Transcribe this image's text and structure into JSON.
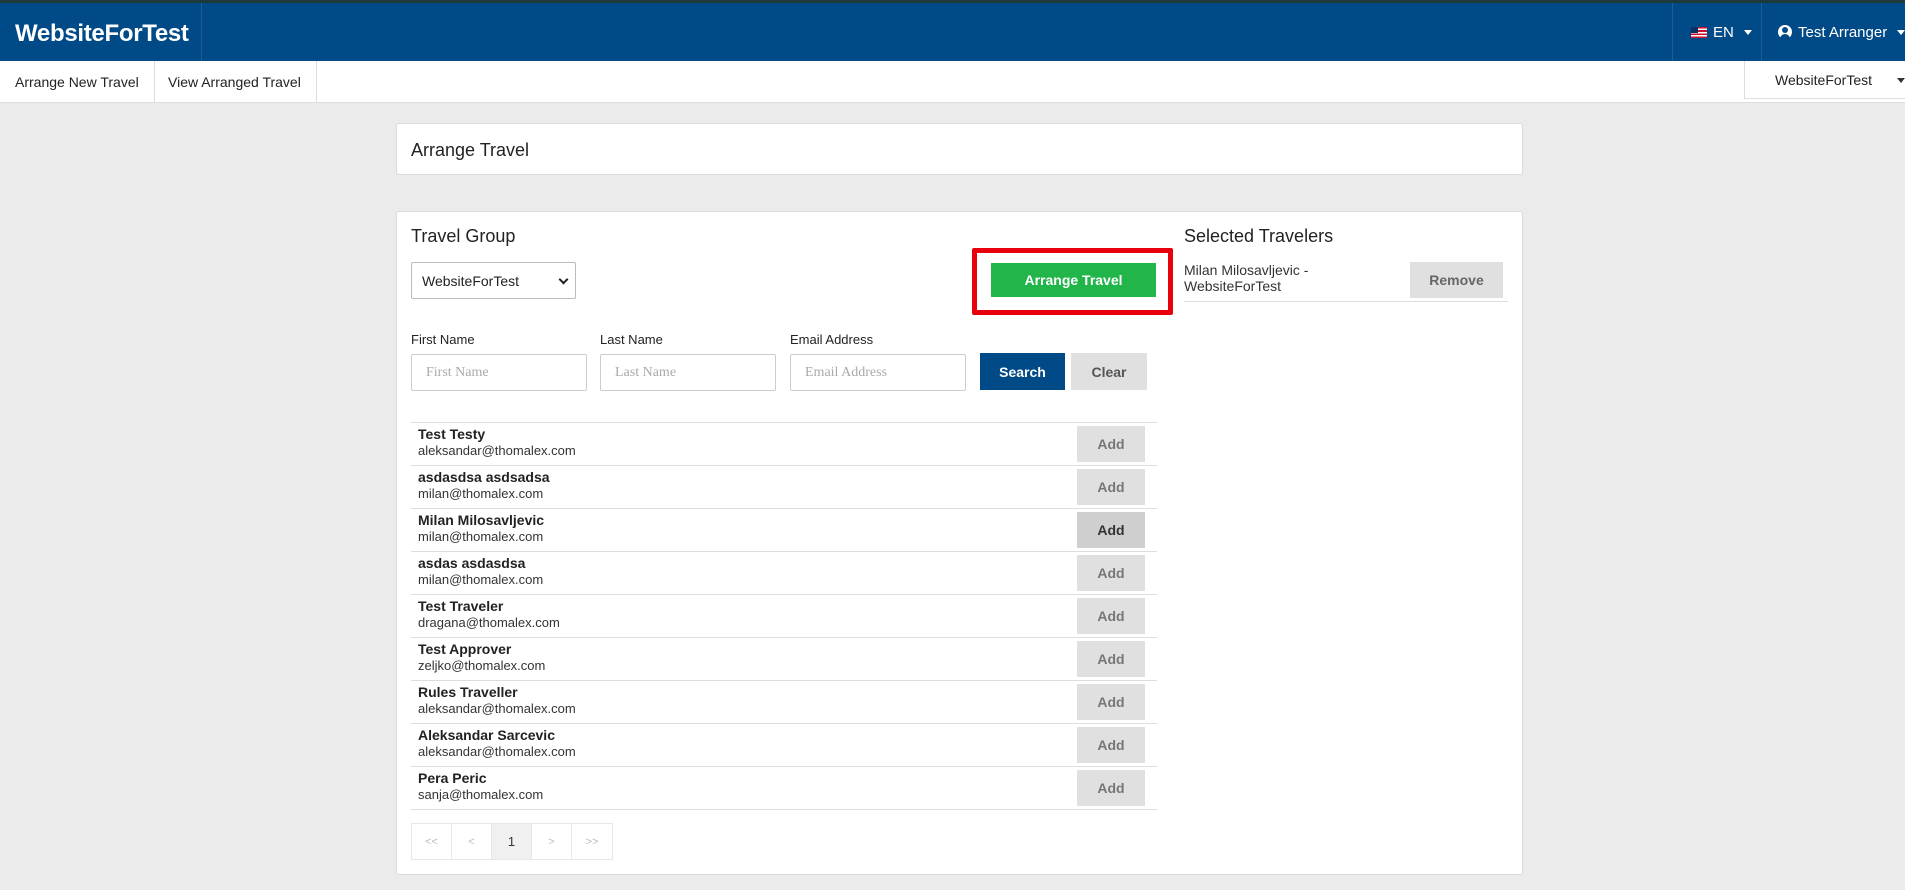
{
  "header": {
    "brand": "WebsiteForTest",
    "language": "EN",
    "user": "Test Arranger"
  },
  "subnav": {
    "items": [
      "Arrange New Travel",
      "View Arranged Travel"
    ],
    "org_selector": "WebsiteForTest"
  },
  "arrange_card": {
    "title": "Arrange Travel"
  },
  "travel_group": {
    "title": "Travel Group",
    "selected_group": "WebsiteForTest",
    "arrange_button": "Arrange Travel"
  },
  "search": {
    "first_name_label": "First Name",
    "first_name_placeholder": "First Name",
    "last_name_label": "Last Name",
    "last_name_placeholder": "Last Name",
    "email_label": "Email Address",
    "email_placeholder": "Email Address",
    "search_button": "Search",
    "clear_button": "Clear"
  },
  "travelers": [
    {
      "name": "Test Testy",
      "email": "aleksandar@thomalex.com",
      "action": "Add"
    },
    {
      "name": "asdasdsa asdsadsa",
      "email": "milan@thomalex.com",
      "action": "Add"
    },
    {
      "name": "Milan Milosavljevic",
      "email": "milan@thomalex.com",
      "action": "Add"
    },
    {
      "name": "asdas asdasdsa",
      "email": "milan@thomalex.com",
      "action": "Add"
    },
    {
      "name": "Test Traveler",
      "email": "dragana@thomalex.com",
      "action": "Add"
    },
    {
      "name": "Test Approver",
      "email": "zeljko@thomalex.com",
      "action": "Add"
    },
    {
      "name": "Rules Traveller",
      "email": "aleksandar@thomalex.com",
      "action": "Add"
    },
    {
      "name": "Aleksandar Sarcevic",
      "email": "aleksandar@thomalex.com",
      "action": "Add"
    },
    {
      "name": "Pera Peric",
      "email": "sanja@thomalex.com",
      "action": "Add"
    }
  ],
  "pagination": {
    "first": "<<",
    "prev": "<",
    "current": "1",
    "next": ">",
    "last": ">>"
  },
  "selected_travelers": {
    "title": "Selected Travelers",
    "items": [
      {
        "name": "Milan Milosavljevic - WebsiteForTest",
        "action": "Remove"
      }
    ]
  }
}
